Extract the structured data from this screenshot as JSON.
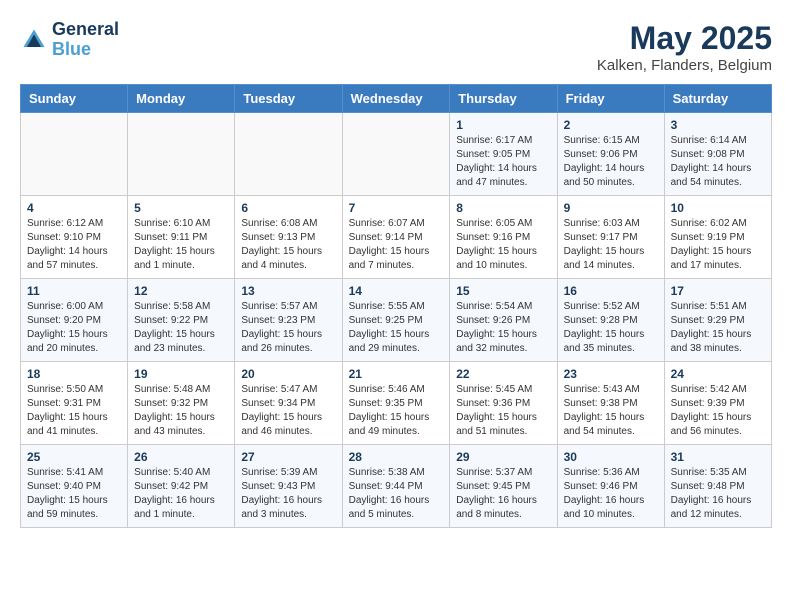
{
  "header": {
    "logo_line1": "General",
    "logo_line2": "Blue",
    "title": "May 2025",
    "subtitle": "Kalken, Flanders, Belgium"
  },
  "weekdays": [
    "Sunday",
    "Monday",
    "Tuesday",
    "Wednesday",
    "Thursday",
    "Friday",
    "Saturday"
  ],
  "weeks": [
    [
      {
        "day": "",
        "info": ""
      },
      {
        "day": "",
        "info": ""
      },
      {
        "day": "",
        "info": ""
      },
      {
        "day": "",
        "info": ""
      },
      {
        "day": "1",
        "info": "Sunrise: 6:17 AM\nSunset: 9:05 PM\nDaylight: 14 hours\nand 47 minutes."
      },
      {
        "day": "2",
        "info": "Sunrise: 6:15 AM\nSunset: 9:06 PM\nDaylight: 14 hours\nand 50 minutes."
      },
      {
        "day": "3",
        "info": "Sunrise: 6:14 AM\nSunset: 9:08 PM\nDaylight: 14 hours\nand 54 minutes."
      }
    ],
    [
      {
        "day": "4",
        "info": "Sunrise: 6:12 AM\nSunset: 9:10 PM\nDaylight: 14 hours\nand 57 minutes."
      },
      {
        "day": "5",
        "info": "Sunrise: 6:10 AM\nSunset: 9:11 PM\nDaylight: 15 hours\nand 1 minute."
      },
      {
        "day": "6",
        "info": "Sunrise: 6:08 AM\nSunset: 9:13 PM\nDaylight: 15 hours\nand 4 minutes."
      },
      {
        "day": "7",
        "info": "Sunrise: 6:07 AM\nSunset: 9:14 PM\nDaylight: 15 hours\nand 7 minutes."
      },
      {
        "day": "8",
        "info": "Sunrise: 6:05 AM\nSunset: 9:16 PM\nDaylight: 15 hours\nand 10 minutes."
      },
      {
        "day": "9",
        "info": "Sunrise: 6:03 AM\nSunset: 9:17 PM\nDaylight: 15 hours\nand 14 minutes."
      },
      {
        "day": "10",
        "info": "Sunrise: 6:02 AM\nSunset: 9:19 PM\nDaylight: 15 hours\nand 17 minutes."
      }
    ],
    [
      {
        "day": "11",
        "info": "Sunrise: 6:00 AM\nSunset: 9:20 PM\nDaylight: 15 hours\nand 20 minutes."
      },
      {
        "day": "12",
        "info": "Sunrise: 5:58 AM\nSunset: 9:22 PM\nDaylight: 15 hours\nand 23 minutes."
      },
      {
        "day": "13",
        "info": "Sunrise: 5:57 AM\nSunset: 9:23 PM\nDaylight: 15 hours\nand 26 minutes."
      },
      {
        "day": "14",
        "info": "Sunrise: 5:55 AM\nSunset: 9:25 PM\nDaylight: 15 hours\nand 29 minutes."
      },
      {
        "day": "15",
        "info": "Sunrise: 5:54 AM\nSunset: 9:26 PM\nDaylight: 15 hours\nand 32 minutes."
      },
      {
        "day": "16",
        "info": "Sunrise: 5:52 AM\nSunset: 9:28 PM\nDaylight: 15 hours\nand 35 minutes."
      },
      {
        "day": "17",
        "info": "Sunrise: 5:51 AM\nSunset: 9:29 PM\nDaylight: 15 hours\nand 38 minutes."
      }
    ],
    [
      {
        "day": "18",
        "info": "Sunrise: 5:50 AM\nSunset: 9:31 PM\nDaylight: 15 hours\nand 41 minutes."
      },
      {
        "day": "19",
        "info": "Sunrise: 5:48 AM\nSunset: 9:32 PM\nDaylight: 15 hours\nand 43 minutes."
      },
      {
        "day": "20",
        "info": "Sunrise: 5:47 AM\nSunset: 9:34 PM\nDaylight: 15 hours\nand 46 minutes."
      },
      {
        "day": "21",
        "info": "Sunrise: 5:46 AM\nSunset: 9:35 PM\nDaylight: 15 hours\nand 49 minutes."
      },
      {
        "day": "22",
        "info": "Sunrise: 5:45 AM\nSunset: 9:36 PM\nDaylight: 15 hours\nand 51 minutes."
      },
      {
        "day": "23",
        "info": "Sunrise: 5:43 AM\nSunset: 9:38 PM\nDaylight: 15 hours\nand 54 minutes."
      },
      {
        "day": "24",
        "info": "Sunrise: 5:42 AM\nSunset: 9:39 PM\nDaylight: 15 hours\nand 56 minutes."
      }
    ],
    [
      {
        "day": "25",
        "info": "Sunrise: 5:41 AM\nSunset: 9:40 PM\nDaylight: 15 hours\nand 59 minutes."
      },
      {
        "day": "26",
        "info": "Sunrise: 5:40 AM\nSunset: 9:42 PM\nDaylight: 16 hours\nand 1 minute."
      },
      {
        "day": "27",
        "info": "Sunrise: 5:39 AM\nSunset: 9:43 PM\nDaylight: 16 hours\nand 3 minutes."
      },
      {
        "day": "28",
        "info": "Sunrise: 5:38 AM\nSunset: 9:44 PM\nDaylight: 16 hours\nand 5 minutes."
      },
      {
        "day": "29",
        "info": "Sunrise: 5:37 AM\nSunset: 9:45 PM\nDaylight: 16 hours\nand 8 minutes."
      },
      {
        "day": "30",
        "info": "Sunrise: 5:36 AM\nSunset: 9:46 PM\nDaylight: 16 hours\nand 10 minutes."
      },
      {
        "day": "31",
        "info": "Sunrise: 5:35 AM\nSunset: 9:48 PM\nDaylight: 16 hours\nand 12 minutes."
      }
    ]
  ]
}
